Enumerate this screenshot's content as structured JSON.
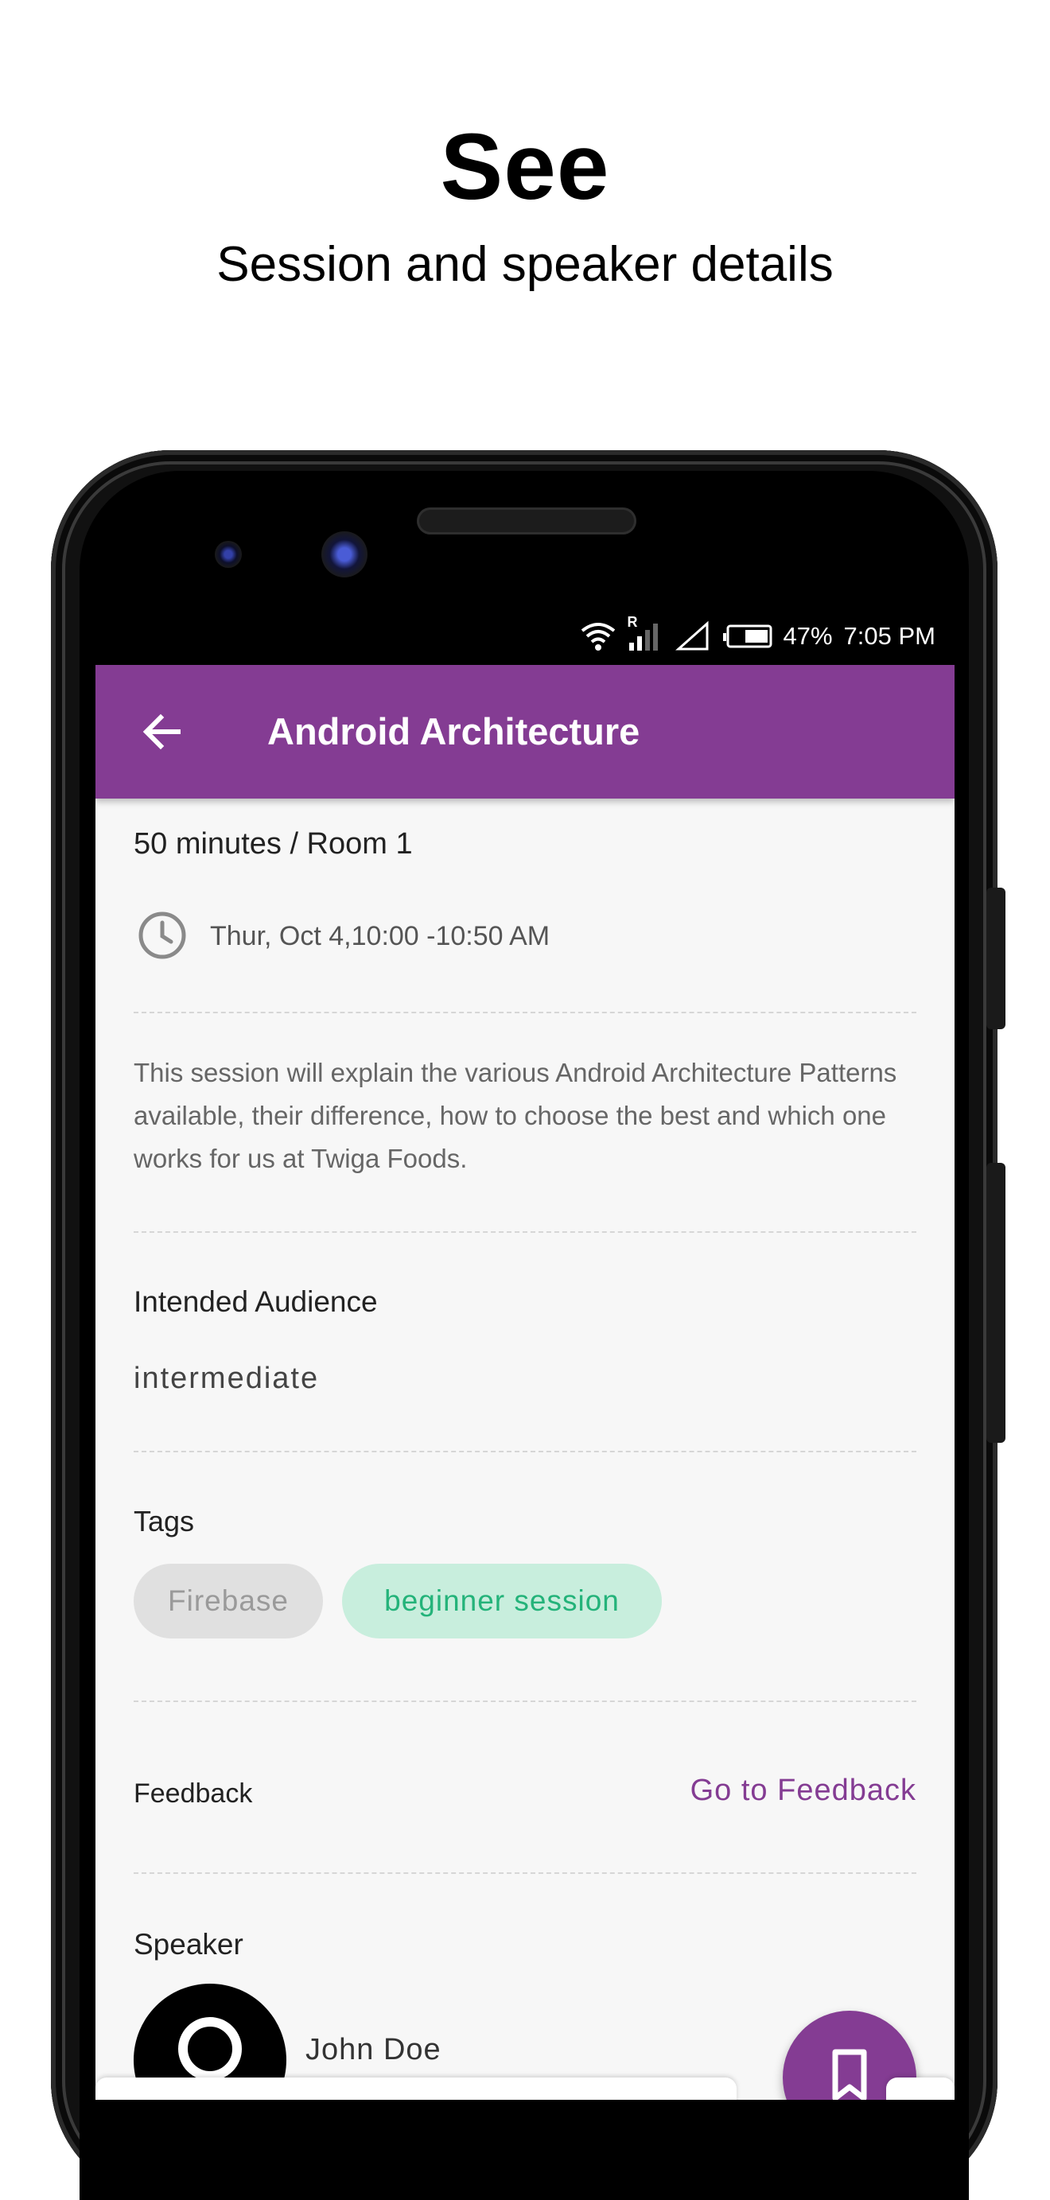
{
  "promo": {
    "title": "See",
    "subtitle": "Session and speaker details"
  },
  "status_bar": {
    "battery": "47%",
    "time": "7:05 PM",
    "roaming_indicator": "R",
    "icons": [
      "wifi-icon",
      "signal-icon",
      "signal-empty-icon",
      "battery-icon"
    ]
  },
  "app_bar": {
    "title": "Android Architecture",
    "back_icon": "arrow-back-icon",
    "color": "#843c93"
  },
  "session": {
    "duration_room": "50 minutes / Room 1",
    "time": "Thur, Oct 4,10:00 -10:50 AM",
    "description": "This session will explain the various Android Architecture Patterns available, their difference, how to choose the best and which one works for us at Twiga Foods.",
    "audience_label": "Intended Audience",
    "audience_value": "intermediate",
    "tags_label": "Tags",
    "tags": [
      {
        "label": "Firebase",
        "bg": "#e0e0e0",
        "fg": "#9a9a9a"
      },
      {
        "label": "beginner session",
        "bg": "#c8eedd",
        "fg": "#24b37a"
      }
    ],
    "feedback_label": "Feedback",
    "feedback_link": "Go to Feedback",
    "speaker_label": "Speaker",
    "speaker_name": "John Doe"
  },
  "fab": {
    "icon": "bookmark-icon"
  }
}
